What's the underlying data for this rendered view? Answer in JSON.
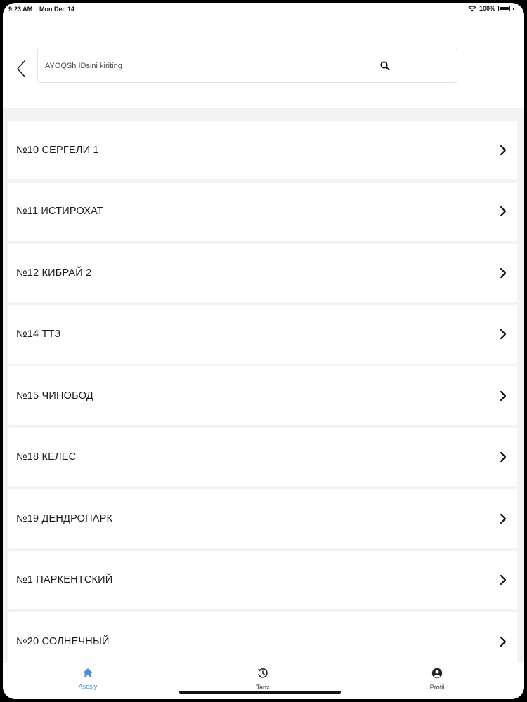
{
  "status_bar": {
    "time": "9:23 AM",
    "date": "Mon Dec 14",
    "battery": "100%",
    "battery_level": 1.0
  },
  "header": {
    "back_icon": "chevron-left-icon",
    "search": {
      "placeholder": "AYOQSh IDsini kiriting",
      "value": "",
      "icon": "search-icon"
    }
  },
  "stations": [
    {
      "label": "№10 СЕРГЕЛИ 1"
    },
    {
      "label": "№11 ИСТИРОХАТ"
    },
    {
      "label": "№12 КИБРАЙ 2"
    },
    {
      "label": "№14 ТТЗ"
    },
    {
      "label": "№15 ЧИНОБОД"
    },
    {
      "label": "№18 КЕЛЕС"
    },
    {
      "label": "№19 ДЕНДРОПАРК"
    },
    {
      "label": "№1 ПАРКЕНТСКИЙ"
    },
    {
      "label": "№20 СОЛНЕЧНЫЙ"
    }
  ],
  "tab_bar": {
    "tabs": [
      {
        "label": "Asosiy",
        "icon": "home-icon",
        "active": true
      },
      {
        "label": "Tarix",
        "icon": "history-icon",
        "active": false
      },
      {
        "label": "Profil",
        "icon": "profile-icon",
        "active": false
      }
    ]
  },
  "colors": {
    "accent": "#4a90d9",
    "list_background": "#f3f2f5",
    "text": "#1c1c1c"
  }
}
